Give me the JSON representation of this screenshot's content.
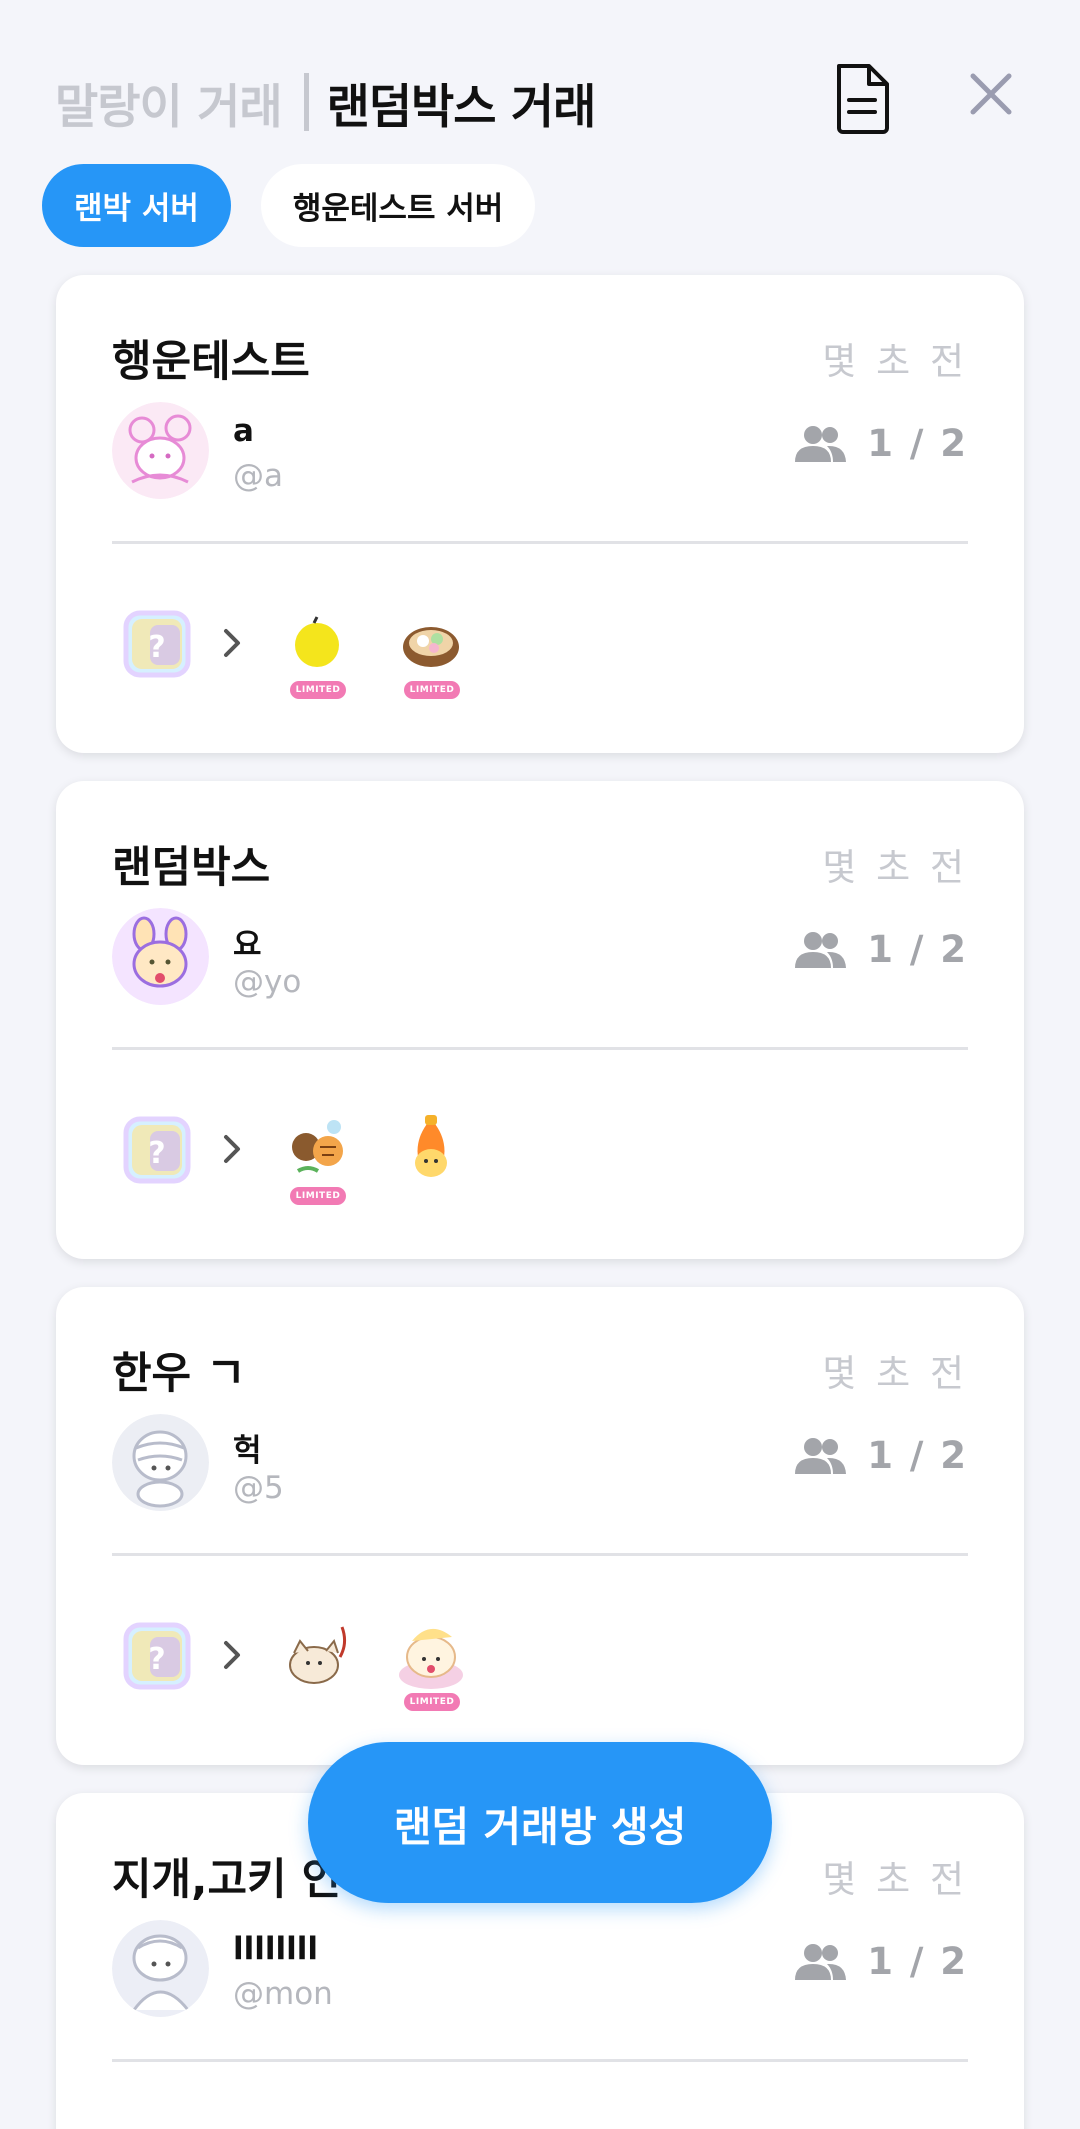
{
  "header": {
    "tab_inactive": "말랑이 거래",
    "tab_active": "랜덤박스 거래"
  },
  "chips": [
    "랜박 서버",
    "행운테스트 서버"
  ],
  "badge_label": "LIMITED",
  "rooms": [
    {
      "title": "행운테스트",
      "time": "몇 초 전",
      "name": "a",
      "handle": "@a",
      "count": "1 / 2"
    },
    {
      "title": "랜덤박스",
      "time": "몇 초 전",
      "name": "요",
      "handle": "@yo",
      "count": "1 / 2"
    },
    {
      "title": "한우 ㄱ",
      "time": "몇 초 전",
      "name": "헉",
      "handle": "@5",
      "count": "1 / 2"
    },
    {
      "title": "지개,고키 인",
      "time": "몇 초 전",
      "name": "llllllll",
      "handle": "@mon",
      "count": "1 / 2"
    }
  ],
  "fab_label": "랜덤 거래방 생성",
  "colors": {
    "accent": "#2696f7",
    "badge": "#f27ab4"
  }
}
